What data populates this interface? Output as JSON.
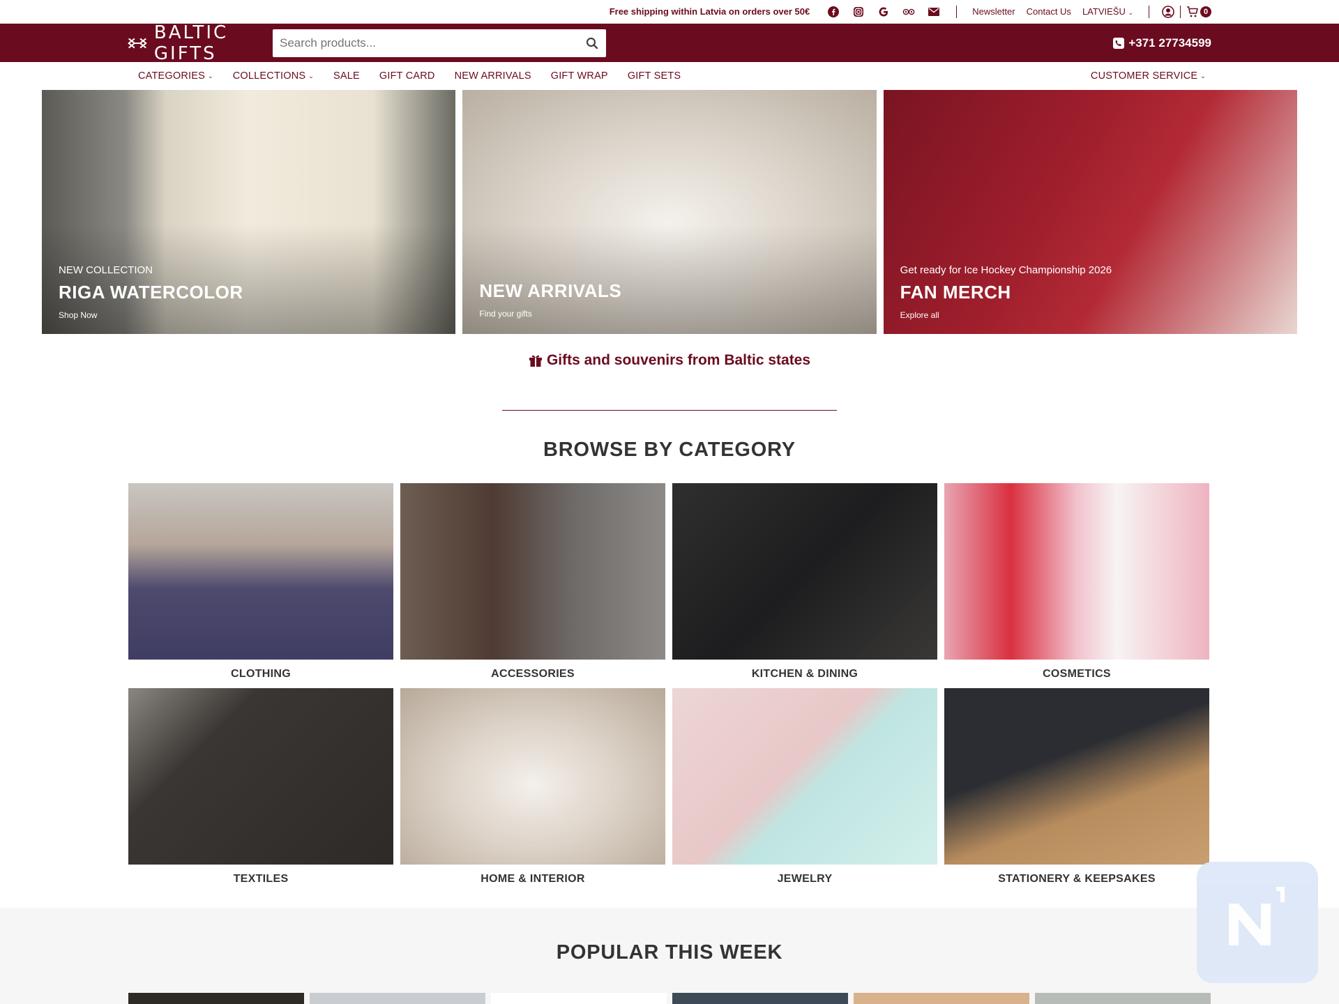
{
  "topbar": {
    "shipping_bold": "Free shipping",
    "shipping_rest": " within Latvia on orders over 50€",
    "social_icons": [
      "facebook-icon",
      "instagram-icon",
      "google-icon",
      "tripadvisor-icon",
      "email-icon"
    ],
    "newsletter": "Newsletter",
    "contact": "Contact Us",
    "language": "LATVIEŠU",
    "cart_count": "0"
  },
  "header": {
    "logo_text": "BALTIC GIFTS",
    "search_placeholder": "Search products...",
    "phone": "+371 27734599"
  },
  "nav": {
    "items": [
      {
        "label": "CATEGORIES",
        "dropdown": true
      },
      {
        "label": "COLLECTIONS",
        "dropdown": true
      },
      {
        "label": "SALE",
        "dropdown": false
      },
      {
        "label": "GIFT CARD",
        "dropdown": false
      },
      {
        "label": "NEW ARRIVALS",
        "dropdown": false
      },
      {
        "label": "GIFT WRAP",
        "dropdown": false
      },
      {
        "label": "GIFT SETS",
        "dropdown": false
      }
    ],
    "customer_service": "CUSTOMER SERVICE"
  },
  "hero": [
    {
      "kicker": "NEW COLLECTION",
      "title": "RIGA WATERCOLOR",
      "sub": "Shop Now"
    },
    {
      "kicker": "",
      "title": "NEW ARRIVALS",
      "sub": "Find your gifts"
    },
    {
      "kicker": "Get ready for Ice Hockey Championship 2026",
      "title": "FAN MERCH",
      "sub": "Explore all"
    }
  ],
  "tagline": "Gifts and souvenirs from Baltic states",
  "browse_title": "BROWSE BY CATEGORY",
  "categories": [
    {
      "label": "CLOTHING"
    },
    {
      "label": "ACCESSORIES"
    },
    {
      "label": "KITCHEN & DINING"
    },
    {
      "label": "COSMETICS"
    },
    {
      "label": "TEXTILES"
    },
    {
      "label": "HOME & INTERIOR"
    },
    {
      "label": "JEWELRY"
    },
    {
      "label": "STATIONERY & KEEPSAKES"
    }
  ],
  "popular_title": "POPULAR THIS WEEK",
  "colors": {
    "brand": "#6b0b1f",
    "text": "#333333",
    "popular_bg": "#f6f6f6"
  }
}
